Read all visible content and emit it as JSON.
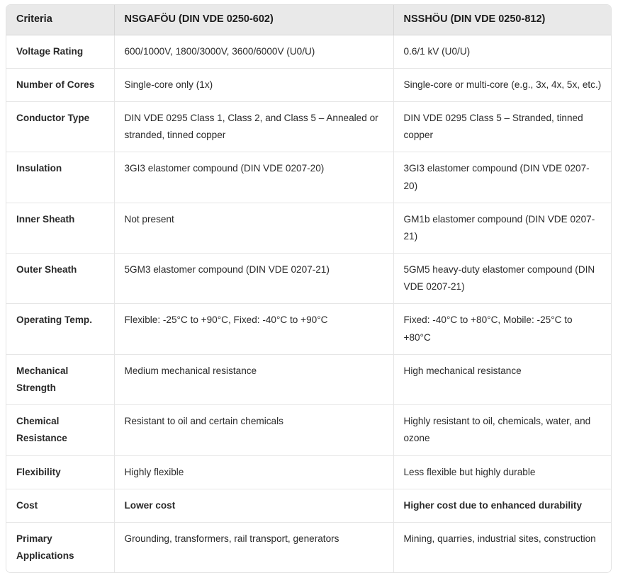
{
  "table": {
    "columns": [
      "Criteria",
      "NSGAFÖU (DIN VDE 0250-602)",
      "NSSHÖU (DIN VDE 0250-812)"
    ],
    "header_background": "#e9e9e9",
    "border_color": "#e2e2e2",
    "rows": [
      {
        "criteria": "Voltage Rating",
        "nsgafou": "600/1000V, 1800/3000V, 3600/6000V (U0/U)",
        "nsshou": "0.6/1 kV (U0/U)",
        "bold_values": false
      },
      {
        "criteria": "Number of Cores",
        "nsgafou": "Single-core only (1x)",
        "nsshou": "Single-core or multi-core (e.g., 3x, 4x, 5x, etc.)",
        "bold_values": false
      },
      {
        "criteria": "Conductor Type",
        "nsgafou": "DIN VDE 0295 Class 1, Class 2, and Class 5 – Annealed or stranded, tinned copper",
        "nsshou": "DIN VDE 0295 Class 5 – Stranded, tinned copper",
        "bold_values": false
      },
      {
        "criteria": "Insulation",
        "nsgafou": "3GI3 elastomer compound (DIN VDE 0207-20)",
        "nsshou": "3GI3 elastomer compound (DIN VDE 0207-20)",
        "bold_values": false
      },
      {
        "criteria": "Inner Sheath",
        "nsgafou": "Not present",
        "nsshou": "GM1b elastomer compound (DIN VDE 0207-21)",
        "bold_values": false
      },
      {
        "criteria": "Outer Sheath",
        "nsgafou": "5GM3 elastomer compound (DIN VDE 0207-21)",
        "nsshou": "5GM5 heavy-duty elastomer compound (DIN VDE 0207-21)",
        "bold_values": false
      },
      {
        "criteria": "Operating Temp.",
        "nsgafou": "Flexible: -25°C to +90°C, Fixed: -40°C to +90°C",
        "nsshou": "Fixed: -40°C to +80°C, Mobile: -25°C to +80°C",
        "bold_values": false
      },
      {
        "criteria": "Mechanical Strength",
        "nsgafou": "Medium mechanical resistance",
        "nsshou": "High mechanical resistance",
        "bold_values": false
      },
      {
        "criteria": "Chemical Resistance",
        "nsgafou": "Resistant to oil and certain chemicals",
        "nsshou": "Highly resistant to oil, chemicals, water, and ozone",
        "bold_values": false
      },
      {
        "criteria": "Flexibility",
        "nsgafou": "Highly flexible",
        "nsshou": "Less flexible but highly durable",
        "bold_values": false
      },
      {
        "criteria": "Cost",
        "nsgafou": "Lower cost",
        "nsshou": "Higher cost due to enhanced durability",
        "bold_values": true
      },
      {
        "criteria": "Primary Applications",
        "nsgafou": "Grounding, transformers, rail transport, generators",
        "nsshou": "Mining, quarries, industrial sites, construction",
        "bold_values": false
      }
    ]
  }
}
